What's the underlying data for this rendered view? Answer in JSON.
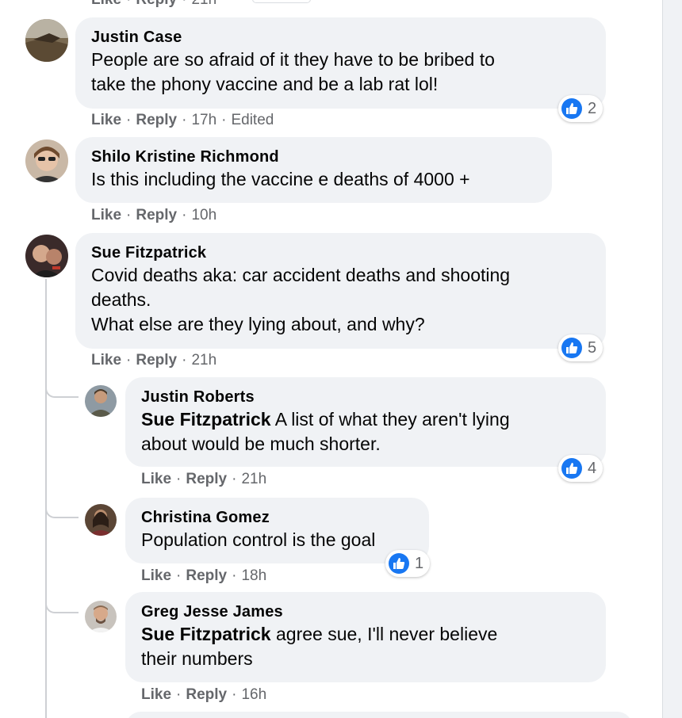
{
  "colors": {
    "bubble": "#f0f2f5",
    "like_blue": "#1877f2",
    "meta_gray": "#65676b"
  },
  "actions": {
    "like": "Like",
    "reply": "Reply",
    "sep": "·"
  },
  "top_partial": {
    "time": "21h"
  },
  "comments": [
    {
      "name": "Justin Case",
      "text": "People are so afraid of it they have to be bribed to\ntake the phony vaccine and be a lab rat lol!",
      "time": "17h",
      "edited": "Edited",
      "reactions": "2",
      "reaction_icon": "thumbs-up-icon"
    },
    {
      "name": "Shilo Kristine Richmond",
      "text": "Is this including the vaccine e deaths of 4000 +",
      "time": "10h"
    },
    {
      "name": "Sue Fitzpatrick",
      "text": "Covid deaths aka: car accident deaths and shooting\ndeaths.\nWhat else are they lying about, and why?",
      "time": "21h",
      "reactions": "5",
      "reaction_icon": "thumbs-up-icon"
    }
  ],
  "replies": [
    {
      "name": "Justin Roberts",
      "mention": "Sue Fitzpatrick",
      "text": " A list of what they aren't lying\nabout would be much shorter.",
      "time": "21h",
      "reactions": "4",
      "reaction_icon": "thumbs-up-icon"
    },
    {
      "name": "Christina Gomez",
      "text": "Population control is the goal",
      "time": "18h",
      "reactions": "1",
      "reaction_icon": "thumbs-up-icon"
    },
    {
      "name": "Greg Jesse James",
      "mention": "Sue Fitzpatrick",
      "text": " agree sue, I'll never believe\ntheir numbers",
      "time": "16h"
    }
  ]
}
